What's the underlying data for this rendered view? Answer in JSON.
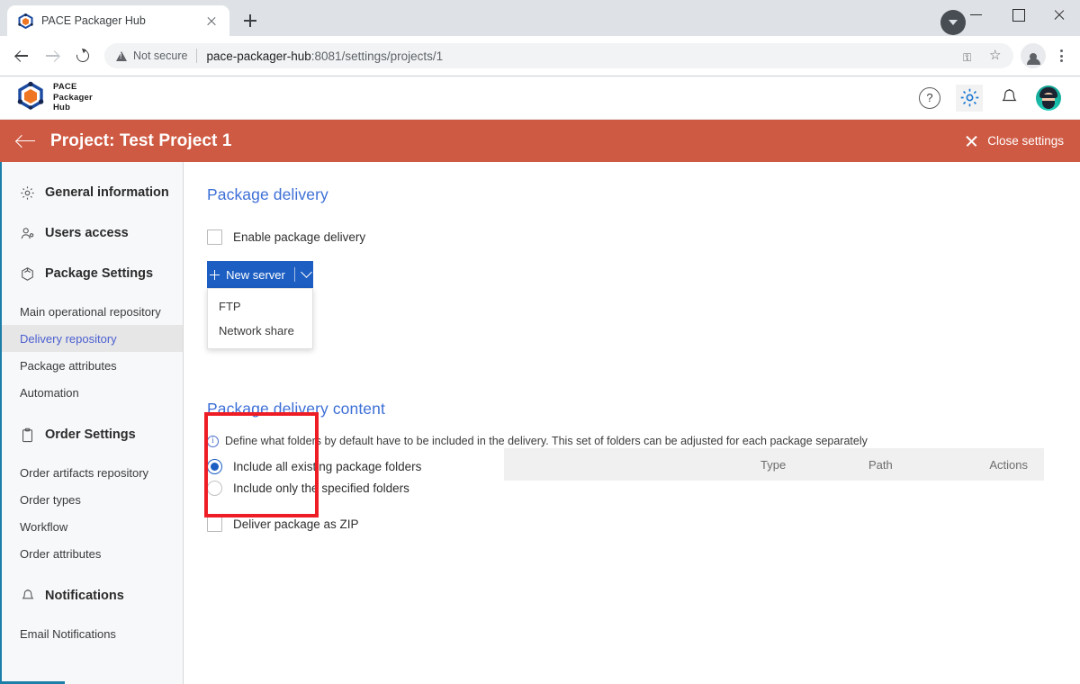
{
  "browser": {
    "tab": {
      "title": "PACE Packager Hub",
      "favicon_icon": "pace-cube-icon",
      "close_icon": "close-icon"
    },
    "new_tab_icon": "plus-icon",
    "window_controls": {
      "minimize_icon": "minimize-icon",
      "maximize_icon": "maximize-icon",
      "close_icon": "close-icon"
    },
    "downloads_icon": "download-arrow-icon",
    "nav": {
      "back_icon": "arrow-left-icon",
      "forward_icon": "arrow-right-icon",
      "reload_icon": "reload-icon"
    },
    "omnibox": {
      "security_icon": "warning-triangle-icon",
      "security_label": "Not secure",
      "url_host": "pace-packager-hub",
      "url_rest": ":8081/settings/projects/1",
      "password_icon": "key-icon",
      "bookmark_icon": "star-icon"
    },
    "profile_icon": "profile-avatar-icon",
    "menu_icon": "kebab-menu-icon"
  },
  "app_header": {
    "logo_icon": "pace-cube-logo",
    "logo_lines": [
      "PACE",
      "Packager",
      "Hub"
    ],
    "icons": [
      {
        "name": "help-icon",
        "glyph": "?"
      },
      {
        "name": "settings-gear-icon",
        "glyph": "⚙"
      },
      {
        "name": "notifications-bell-icon",
        "glyph": "☐"
      },
      {
        "name": "user-avatar",
        "glyph": ""
      }
    ]
  },
  "project_bar": {
    "back_icon": "arrow-left-icon",
    "title": "Project: Test Project 1",
    "close_label": "Close settings",
    "close_icon": "close-icon",
    "background_color": "#cf5a43"
  },
  "sidebar": {
    "groups": [
      {
        "label": "General information",
        "icon": "gear-icon"
      },
      {
        "label": "Users access",
        "icon": "users-icon"
      },
      {
        "label": "Package Settings",
        "icon": "cube-icon"
      }
    ],
    "package_items": [
      {
        "label": "Main operational repository",
        "selected": false
      },
      {
        "label": "Delivery repository",
        "selected": true
      },
      {
        "label": "Package attributes",
        "selected": false
      },
      {
        "label": "Automation",
        "selected": false
      }
    ],
    "order_group": {
      "label": "Order Settings",
      "icon": "clipboard-icon"
    },
    "order_items": [
      {
        "label": "Order artifacts repository"
      },
      {
        "label": "Order types"
      },
      {
        "label": "Workflow"
      },
      {
        "label": "Order attributes"
      }
    ],
    "notifications_group": {
      "label": "Notifications",
      "icon": "bell-icon"
    },
    "notification_items": [
      {
        "label": "Email Notifications"
      }
    ],
    "selected_color": "#4b5fd0"
  },
  "main": {
    "section1": {
      "title": "Package delivery",
      "enable_checkbox": {
        "label": "Enable package delivery",
        "checked": false
      },
      "new_server_button": {
        "label": "New server",
        "plus_icon": "plus-icon",
        "chevron_icon": "chevron-down-icon",
        "color": "#1c5ec2"
      },
      "dropdown_options": [
        {
          "label": "FTP"
        },
        {
          "label": "Network share"
        }
      ],
      "table_headers": [
        "Type",
        "Path",
        "Actions"
      ]
    },
    "section2": {
      "title": "Package delivery content",
      "hint_icon": "info-icon",
      "hint": "Define what folders by default have to be included in the delivery. This set of folders can be adjusted for each package separately",
      "radios": [
        {
          "label": "Include all existing package folders",
          "selected": true
        },
        {
          "label": "Include only the specified folders",
          "selected": false
        }
      ],
      "zip_checkbox": {
        "label": "Deliver package as ZIP",
        "checked": false
      }
    }
  },
  "annotation": {
    "highlight_color": "#ee1d25"
  }
}
